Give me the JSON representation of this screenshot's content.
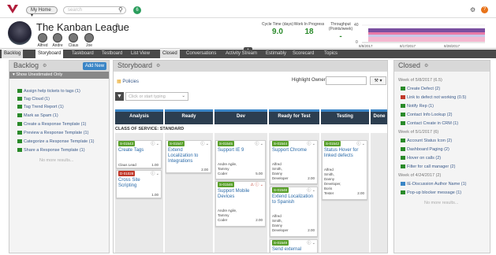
{
  "topbar": {
    "home_label": "My Home ▾",
    "search_placeholder": "search",
    "notification_count": "6",
    "help": "?"
  },
  "team": {
    "name": "The Kanban League",
    "members": [
      "Alfred",
      "Andre",
      "Claus",
      "Joe"
    ],
    "metrics": [
      {
        "label": "Cycle Time (days)",
        "value": "9.0"
      },
      {
        "label": "Work In Progress",
        "value": "18"
      },
      {
        "label": "Throughput (Points/week)",
        "value": "-"
      }
    ],
    "chart": {
      "y_ticks": [
        "40",
        "0"
      ],
      "x_ticks": [
        "8/8/2017",
        "8/17/2017",
        "8/28/2017"
      ]
    }
  },
  "tabs": [
    "Backlog",
    "Storyboard",
    "Taskboard",
    "Testboard",
    "List View",
    "Closed",
    "Conversations",
    "Activity Stream",
    "Estimably",
    "Scorecard",
    "Topics"
  ],
  "backlog": {
    "title": "Backlog",
    "add_label": "Add New",
    "filter_label": "▾ Show Unestimated Only",
    "items": [
      "Assign help tickets to tags (1)",
      "Tag Cloud (1)",
      "Tag Trend Report (1)",
      "Mark as Spam (1)",
      "Create a Response Template (1)",
      "Preview a Response Template (1)",
      "Categorize a Response Template (1)",
      "Share a Response Template (1)"
    ],
    "more": "No more results..."
  },
  "board": {
    "title": "Storyboard",
    "policies_label": "Policies",
    "highlight_label": "Highlight Owner:",
    "filter_placeholder": "Click or start typing",
    "columns": [
      "Analysis",
      "Ready",
      "Dev",
      "Ready for Test",
      "Testing",
      "Done"
    ],
    "class_of_service": "CLASS OF SERVICE: STANDARD",
    "cards": [
      {
        "id": "S-01543",
        "title": "Create Tags",
        "people": [
          "Claus Lead"
        ],
        "size": "1.00"
      },
      {
        "id": "D-01028",
        "title": "Cross Site Scripting",
        "people": [],
        "size": "1.00"
      },
      {
        "id": "S-01547",
        "title": "Extend Localization to Integrations",
        "people": [],
        "size": "2.00"
      },
      {
        "id": "S-01545",
        "title": "Support IE 9",
        "people": [
          "Andre Agile,",
          "Tammy",
          "Coder"
        ],
        "size": "5.00"
      },
      {
        "id": "S-01546",
        "title": "Support Mobile Devices",
        "people": [
          "Andre Agile,",
          "Tammy",
          "Coder"
        ],
        "size": "2.00"
      },
      {
        "id": "S-01544",
        "title": "Support Chrome",
        "people": [
          "Alfred",
          "Smith,",
          "Danny",
          "Developer"
        ],
        "size": "2.00"
      },
      {
        "id": "S-01548",
        "title": "Extend Localization to Spanish",
        "people": [
          "Alfred",
          "Smith,",
          "Danny",
          "Developer"
        ],
        "size": "2.00"
      },
      {
        "id": "S-01549",
        "title": "Send external",
        "people": [],
        "size": ""
      },
      {
        "id": "S-01542",
        "title": "Status Hover for linked defects",
        "people": [
          "Alfred",
          "Smith,",
          "Danny",
          "Developer,",
          "Boris",
          "Tester"
        ],
        "size": "2.00"
      }
    ]
  },
  "closed": {
    "title": "Closed",
    "weeks": [
      {
        "label": "Week of 5/8/2017 (6.5)",
        "items": [
          "Create Defect (2)",
          "Link to defect not working (0.5)",
          "Notify Rep (1)",
          "Contact Info Lookup (2)",
          "Contact Create in CRM (1)"
        ]
      },
      {
        "label": "Week of 5/1/2017 (6)",
        "items": [
          "Account Status Icon (2)",
          "Dashboard Paging (2)",
          "Hover on calls (2)",
          "Filter for call manager (2)"
        ]
      },
      {
        "label": "Week of 4/24/2017 (2)",
        "items": [
          "IE-Discussion Author Name (1)",
          "Pop-up blocker message (1)"
        ]
      }
    ],
    "more": "No more results..."
  },
  "colors": {
    "accent": "#3a85c6",
    "story": "#5aa02c",
    "defect": "#c0392b",
    "header": "#2c3e50"
  }
}
